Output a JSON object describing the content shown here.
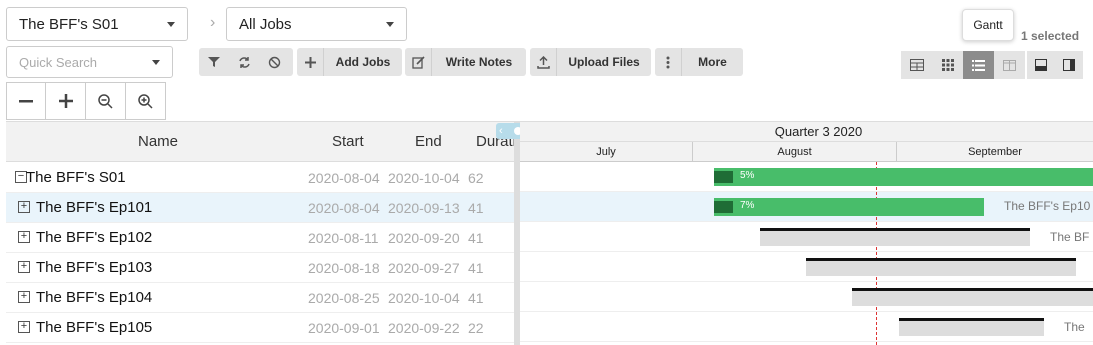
{
  "header": {
    "project_select": "The BFF's S01",
    "breadcrumb_sep": "›",
    "jobs_select": "All Jobs",
    "search_placeholder": "Quick Search",
    "selected_count": "1 selected",
    "tooltip": "Gantt"
  },
  "toolbar": {
    "add_jobs": "Add Jobs",
    "write_notes": "Write Notes",
    "upload_files": "Upload Files",
    "more": "More"
  },
  "grid": {
    "columns": {
      "name": "Name",
      "start": "Start",
      "end": "End",
      "duration": "Durati"
    },
    "rows": [
      {
        "expander": "−",
        "name": "The BFF's S01",
        "start": "2020-08-04",
        "end": "2020-10-04",
        "duration": "62"
      },
      {
        "expander": "+",
        "name": "The BFF's Ep101",
        "start": "2020-08-04",
        "end": "2020-09-13",
        "duration": "41"
      },
      {
        "expander": "+",
        "name": "The BFF's Ep102",
        "start": "2020-08-11",
        "end": "2020-09-20",
        "duration": "41"
      },
      {
        "expander": "+",
        "name": "The BFF's Ep103",
        "start": "2020-08-18",
        "end": "2020-09-27",
        "duration": "41"
      },
      {
        "expander": "+",
        "name": "The BFF's Ep104",
        "start": "2020-08-25",
        "end": "2020-10-04",
        "duration": "41"
      },
      {
        "expander": "+",
        "name": "The BFF's Ep105",
        "start": "2020-09-01",
        "end": "2020-09-22",
        "duration": "22"
      }
    ]
  },
  "gantt": {
    "quarter": "Quarter 3 2020",
    "months": [
      "July",
      "August",
      "September"
    ],
    "bars": [
      {
        "percent": "5%",
        "progress": 0.05,
        "color": "#48bd6a"
      },
      {
        "percent": "7%",
        "progress": 0.07,
        "color": "#48bd6a",
        "label": "The BFF's Ep10"
      },
      {
        "label": "The BF"
      },
      {
        "label": ""
      },
      {
        "label": ""
      },
      {
        "label": "The"
      }
    ]
  }
}
